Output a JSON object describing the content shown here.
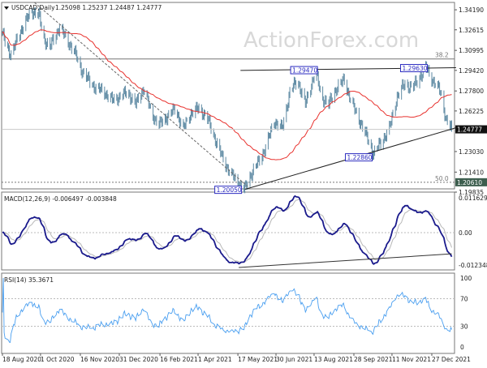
{
  "chart_data": {
    "type": "ohlc",
    "symbol_label": "USDCAD,Daily",
    "ohlc_readout": "1.25098 1.25237 1.24487 1.24777",
    "watermark": "ActionForex.com",
    "colors": {
      "bars": "#5e8aa3",
      "ma": "#e8322e",
      "macd": "#1a1a8c",
      "signal": "#b8b8b8",
      "rsi": "#4a9ff0",
      "last_price_bg": "#111111"
    },
    "price": {
      "ylim": [
        1.19835,
        1.3477
      ],
      "ticks": [
        "1.34190",
        "1.32615",
        "1.30995",
        "1.29420",
        "1.27800",
        "1.26225",
        "1.23030",
        "1.21410",
        "1.19835"
      ],
      "last_price": "1.24777",
      "last_value": 1.24777,
      "points": [
        [
          "2020-08-18",
          1.3222
        ],
        [
          "2020-08-28",
          1.3061
        ],
        [
          "2020-09-08",
          1.3254
        ],
        [
          "2020-09-21",
          1.3413
        ],
        [
          "2020-09-29",
          1.338
        ],
        [
          "2020-10-05",
          1.319
        ],
        [
          "2020-10-12",
          1.3125
        ],
        [
          "2020-10-23",
          1.3287
        ],
        [
          "2020-10-28",
          1.3222
        ],
        [
          "2020-11-06",
          1.3125
        ],
        [
          "2020-11-11",
          1.3061
        ],
        [
          "2020-11-16",
          1.2964
        ],
        [
          "2020-11-25",
          1.2867
        ],
        [
          "2020-12-04",
          1.2803
        ],
        [
          "2020-12-14",
          1.277
        ],
        [
          "2020-12-23",
          1.2706
        ],
        [
          "2021-01-01",
          1.2738
        ],
        [
          "2021-01-10",
          1.277
        ],
        [
          "2021-01-19",
          1.2674
        ],
        [
          "2021-01-28",
          1.2803
        ],
        [
          "2021-02-06",
          1.2609
        ],
        [
          "2021-02-15",
          1.2512
        ],
        [
          "2021-02-24",
          1.2577
        ],
        [
          "2021-03-06",
          1.2641
        ],
        [
          "2021-03-15",
          1.248
        ],
        [
          "2021-03-24",
          1.2609
        ],
        [
          "2021-04-02",
          1.2641
        ],
        [
          "2021-04-11",
          1.2577
        ],
        [
          "2021-04-20",
          1.2416
        ],
        [
          "2021-04-29",
          1.2254
        ],
        [
          "2021-05-09",
          1.2125
        ],
        [
          "2021-05-18",
          1.205
        ],
        [
          "2021-05-25",
          1.2005
        ],
        [
          "2021-06-01",
          1.2125
        ],
        [
          "2021-06-10",
          1.2222
        ],
        [
          "2021-06-19",
          1.2351
        ],
        [
          "2021-06-28",
          1.2545
        ],
        [
          "2021-07-07",
          1.248
        ],
        [
          "2021-07-16",
          1.277
        ],
        [
          "2021-07-25",
          1.2867
        ],
        [
          "2021-08-03",
          1.2674
        ],
        [
          "2021-08-15",
          1.2947
        ],
        [
          "2021-08-21",
          1.2738
        ],
        [
          "2021-08-30",
          1.2674
        ],
        [
          "2021-09-08",
          1.2803
        ],
        [
          "2021-09-17",
          1.2867
        ],
        [
          "2021-09-26",
          1.2674
        ],
        [
          "2021-10-05",
          1.2545
        ],
        [
          "2021-10-21",
          1.2286
        ],
        [
          "2021-10-30",
          1.2383
        ],
        [
          "2021-11-08",
          1.248
        ],
        [
          "2021-11-17",
          1.2738
        ],
        [
          "2021-11-26",
          1.2835
        ],
        [
          "2021-12-05",
          1.2803
        ],
        [
          "2021-12-14",
          1.2899
        ],
        [
          "2021-12-20",
          1.2963
        ],
        [
          "2021-12-28",
          1.2867
        ],
        [
          "2022-01-06",
          1.277
        ],
        [
          "2022-01-13",
          1.2545
        ],
        [
          "2022-01-19",
          1.2478
        ]
      ]
    },
    "fib_levels": [
      {
        "label": "38.2",
        "value": 1.3032,
        "style": "solid"
      },
      {
        "label": "50.0",
        "value": 1.2061,
        "style": "dotted",
        "price_label": "1.20610"
      }
    ],
    "annotations": [
      {
        "text": "1.29470",
        "date": "2021-08-15",
        "value": 1.2947
      },
      {
        "text": "1.29630",
        "date": "2021-12-20",
        "value": 1.2963
      },
      {
        "text": "1.22860",
        "date": "2021-10-21",
        "value": 1.2286
      },
      {
        "text": "1.20050",
        "date": "2021-05-25",
        "value": 1.2005
      }
    ],
    "trendlines": [
      {
        "from": [
          "2021-05-25",
          1.2005
        ],
        "to": [
          "2022-01-24",
          1.249
        ],
        "style": "solid"
      },
      {
        "from": [
          "2021-05-20",
          1.2942
        ],
        "to": [
          "2022-01-24",
          1.2963
        ],
        "style": "solid"
      },
      {
        "from": [
          "2020-09-24",
          1.3477
        ],
        "to": [
          "2021-05-28",
          1.203
        ],
        "style": "dashed"
      }
    ],
    "ma_period": 55,
    "macd": {
      "label": "MACD(12,26,9) -0.006497 -0.003848",
      "ticks": [
        "0.011629",
        "0.00",
        "-0.012348"
      ],
      "ylim": [
        -0.0135,
        0.0128
      ],
      "trendline": {
        "from": [
          "2021-05-18",
          -0.0125
        ],
        "to": [
          "2022-01-19",
          -0.0076
        ]
      }
    },
    "rsi": {
      "label": "RSI(14) 35.3671",
      "ticks": [
        "100",
        "70",
        "30",
        "0"
      ],
      "levels": [
        70,
        30
      ],
      "period": 14
    },
    "x_ticks": [
      [
        "2020-08-18",
        "18 Aug 2020"
      ],
      [
        "2020-10-01",
        "1 Oct 2020"
      ],
      [
        "2020-11-16",
        "16 Nov 2020"
      ],
      [
        "2020-12-31",
        "31 Dec 2020"
      ],
      [
        "2021-02-16",
        "16 Feb 2021"
      ],
      [
        "2021-04-01",
        "1 Apr 2021"
      ],
      [
        "2021-05-17",
        "17 May 2021"
      ],
      [
        "2021-06-30",
        "30 Jun 2021"
      ],
      [
        "2021-08-13",
        "13 Aug 2021"
      ],
      [
        "2021-09-28",
        "28 Sep 2021"
      ],
      [
        "2021-11-11",
        "11 Nov 2021"
      ],
      [
        "2021-12-27",
        "27 Dec 2021"
      ]
    ]
  }
}
